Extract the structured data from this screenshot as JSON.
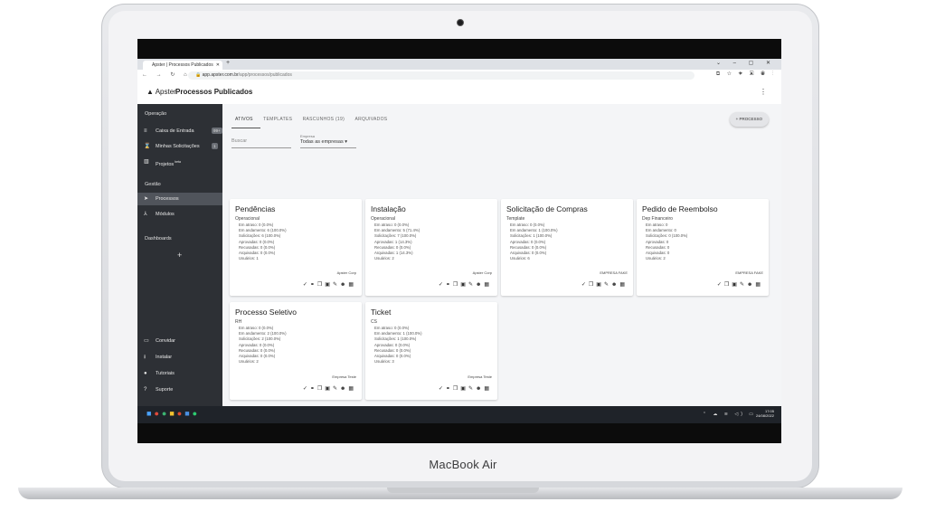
{
  "device": {
    "brand": "MacBook Air"
  },
  "browser": {
    "tab_title": "Apster | Processos Publicados",
    "url_domain": "app.apster.com.br",
    "url_path": "/app/processos/publicados"
  },
  "app": {
    "logo_text": "Apster",
    "page_title": "Processos Publicados"
  },
  "sidebar": {
    "section_operacao": "Operação",
    "caixa": {
      "label": "Caixa de Entrada",
      "badge": "99+"
    },
    "solicitacoes": {
      "label": "Minhas Solicitações",
      "badge": "1"
    },
    "projetos": {
      "label": "Projetos",
      "tag": "beta"
    },
    "section_gestao": "Gestão",
    "processos": {
      "label": "Processos"
    },
    "modulos": {
      "label": "Módulos"
    },
    "section_dashboards": "Dashboards",
    "add": "+",
    "convidar": "Convidar",
    "instalar": "Instalar",
    "tutoriais": "Tutoriais",
    "suporte": "Suporte"
  },
  "main": {
    "tabs": [
      "ATIVOS",
      "TEMPLATES",
      "RASCUNHOS (19)",
      "ARQUIVADOS"
    ],
    "new_process_button": "+ PROCESSO",
    "search_placeholder": "Buscar",
    "empresa_label": "Empresa",
    "empresa_value": "Todas as empresas"
  },
  "cards": [
    {
      "title": "Pendências",
      "subtitle": "Operacional",
      "stats": [
        "Em atraso: 0 (0.0%)",
        "Em andamento: 6 (100.0%)",
        "Solicitações: 6 (100.0%)",
        "Aprovadas: 0 (0.0%)",
        "Recusadas: 0 (0.0%)",
        "Arquivadas: 0 (0.0%)",
        "Usuários: 1"
      ],
      "company": "Apster Corp"
    },
    {
      "title": "Instalação",
      "subtitle": "Operacional",
      "stats": [
        "Em atraso: 0 (0.0%)",
        "Em andamento: 5 (71.4%)",
        "Solicitações: 7 (100.0%)",
        "Aprovadas: 1 (14.3%)",
        "Recusadas: 0 (0.0%)",
        "Arquivadas: 1 (14.3%)",
        "Usuários: 2"
      ],
      "company": "Apster Corp"
    },
    {
      "title": "Solicitação de Compras",
      "subtitle": "Template",
      "stats": [
        "Em atraso: 0 (0.0%)",
        "Em andamento: 1 (100.0%)",
        "Solicitações: 1 (100.0%)",
        "Aprovadas: 0 (0.0%)",
        "Recusadas: 0 (0.0%)",
        "Arquivadas: 0 (0.0%)",
        "Usuários: 6"
      ],
      "company": "EMPRESA FAKE"
    },
    {
      "title": "Pedido de Reembolso",
      "subtitle": "Dep Financeiro",
      "stats": [
        "Em atraso: 0",
        "Em andamento: 0",
        "Solicitações: 0 (100.0%)",
        "Aprovadas: 0",
        "Recusadas: 0",
        "Arquivadas: 0",
        "Usuários: 2"
      ],
      "company": "EMPRESA FAKE"
    },
    {
      "title": "Processo Seletivo",
      "subtitle": "RH",
      "stats": [
        "Em atraso: 0 (0.0%)",
        "Em andamento: 2 (100.0%)",
        "Solicitações: 2 (100.0%)",
        "Aprovadas: 0 (0.0%)",
        "Recusadas: 0 (0.0%)",
        "Arquivadas: 0 (0.0%)",
        "Usuários: 2"
      ],
      "company": "Empresa Teste"
    },
    {
      "title": "Ticket",
      "subtitle": "CS",
      "stats": [
        "Em atraso: 0 (0.0%)",
        "Em andamento: 1 (100.0%)",
        "Solicitações: 1 (100.0%)",
        "Aprovadas: 0 (0.0%)",
        "Recusadas: 0 (0.0%)",
        "Arquivadas: 0 (0.0%)",
        "Usuários: 3"
      ],
      "company": "Empresa Teste"
    }
  ],
  "taskbar": {
    "time": "17:05",
    "date": "24/08/2022"
  }
}
